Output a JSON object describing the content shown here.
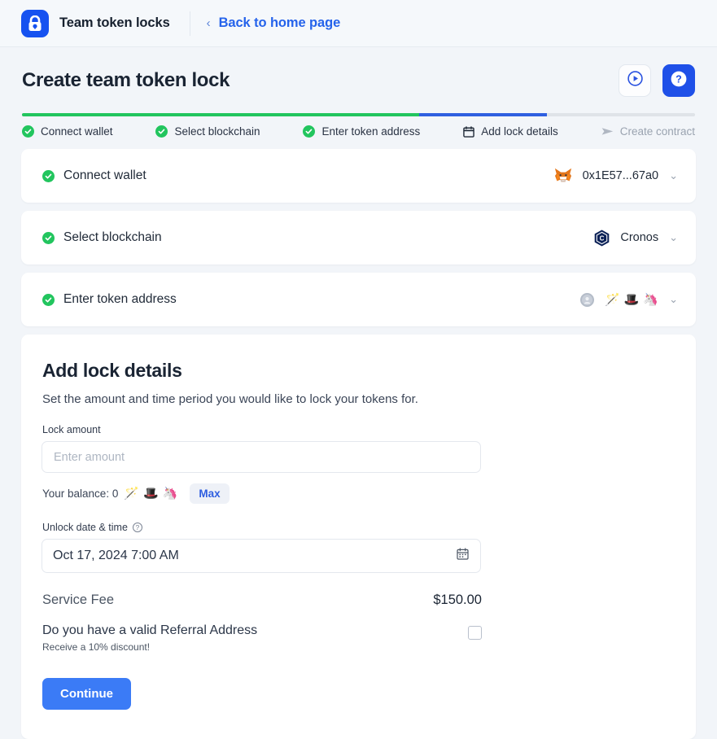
{
  "navbar": {
    "brand_name": "Team token locks",
    "logo_icon": "lock-icon",
    "back_chevron": "‹",
    "back_label": "Back to home page"
  },
  "header": {
    "title": "Create team token lock",
    "buttons": [
      {
        "name": "tutorial-video-button",
        "icon": "play-circle-icon"
      },
      {
        "name": "help-button",
        "icon": "question-mark-icon"
      }
    ]
  },
  "stepper": {
    "progress": {
      "green_pct": 59,
      "blue_pct": 19,
      "gray_pct": 22
    },
    "steps": [
      {
        "label": "Connect wallet",
        "icon": "check-circle-icon",
        "state": "complete"
      },
      {
        "label": "Select blockchain",
        "icon": "check-circle-icon",
        "state": "complete"
      },
      {
        "label": "Enter token address",
        "icon": "check-circle-icon",
        "state": "complete"
      },
      {
        "label": "Add lock details",
        "icon": "calendar-icon",
        "state": "current"
      },
      {
        "label": "Create contract",
        "icon": "send-icon",
        "state": "pending"
      }
    ]
  },
  "accordions": [
    {
      "title": "Connect wallet",
      "status_icon": "check-circle-icon",
      "value": "0x1E57...67a0",
      "value_icon": "metamask-fox-icon",
      "chevron": "⌄"
    },
    {
      "title": "Select blockchain",
      "status_icon": "check-circle-icon",
      "value": "Cronos",
      "value_icon": "cronos-logo-icon",
      "chevron": "⌄"
    },
    {
      "title": "Enter token address",
      "status_icon": "check-circle-icon",
      "value": "",
      "value_icon": "token-logo-icon",
      "emojis": [
        "🪄",
        "🎩",
        "🦄"
      ],
      "chevron": "⌄"
    }
  ],
  "panel": {
    "title": "Add lock details",
    "subtitle": "Set the amount and time period you would like to lock your tokens for.",
    "lock_amount": {
      "label": "Lock amount",
      "placeholder": "Enter amount",
      "value": ""
    },
    "balance": {
      "text": "Your balance: 0",
      "emojis": [
        "🪄",
        "🎩",
        "🦄"
      ],
      "max_label": "Max"
    },
    "unlock_date": {
      "label": "Unlock date & time",
      "help_icon": "question-circle-icon",
      "value": "Oct 17, 2024 7:00 AM",
      "calendar_icon": "calendar-icon"
    },
    "fee": {
      "label": "Service Fee",
      "value": "$150.00"
    },
    "referral": {
      "title": "Do you have a valid Referral Address",
      "subtitle": "Receive a 10% discount!",
      "checked": false
    },
    "continue_label": "Continue"
  },
  "colors": {
    "brand_blue": "#1652f0",
    "link_blue": "#2563eb",
    "primary_blue": "#3b7bf6",
    "success_green": "#22c55e",
    "page_bg": "#f2f5f9",
    "muted_text": "#9aa3b0"
  }
}
